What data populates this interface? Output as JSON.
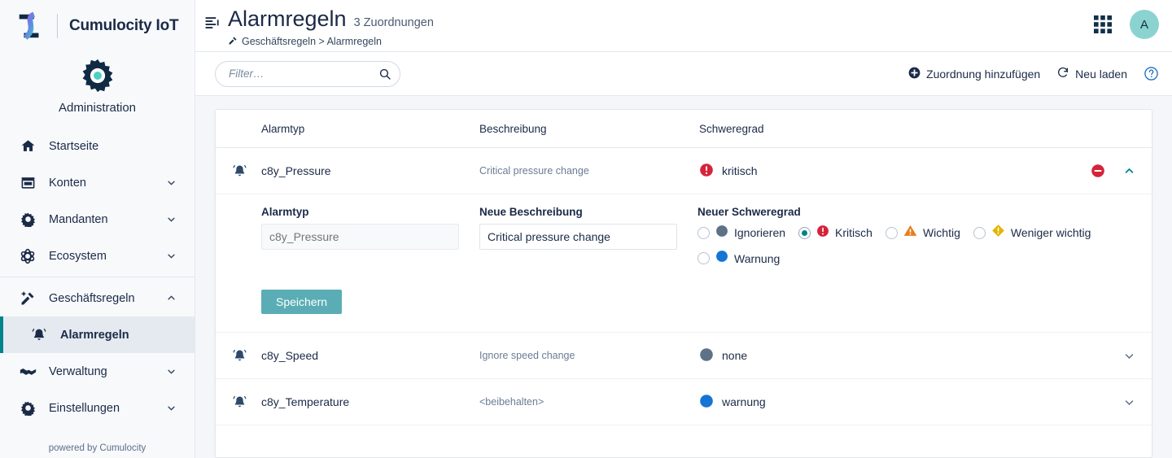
{
  "brand": {
    "name": "Cumulocity IoT",
    "app_title": "Administration",
    "footer": "powered by Cumulocity"
  },
  "sidebar": {
    "items": [
      {
        "label": "Startseite",
        "icon": "home-icon",
        "expandable": false,
        "active": false
      },
      {
        "label": "Konten",
        "icon": "accounts-icon",
        "expandable": true,
        "active": false
      },
      {
        "label": "Mandanten",
        "icon": "tenants-gear-icon",
        "expandable": true,
        "active": false
      },
      {
        "label": "Ecosystem",
        "icon": "ecosystem-atom-icon",
        "expandable": true,
        "active": false
      },
      {
        "label": "Geschäftsregeln",
        "icon": "business-rules-icon",
        "expandable": true,
        "expanded": true,
        "active": false
      },
      {
        "label": "Alarmregeln",
        "icon": "alarm-bell-icon",
        "expandable": false,
        "active": true,
        "sub": true
      },
      {
        "label": "Verwaltung",
        "icon": "management-handshake-icon",
        "expandable": true,
        "active": false
      },
      {
        "label": "Einstellungen",
        "icon": "settings-gear-icon",
        "expandable": true,
        "active": false
      }
    ]
  },
  "header": {
    "title": "Alarmregeln",
    "count": "3 Zuordnungen",
    "breadcrumb": "Geschäftsregeln > Alarmregeln",
    "avatar_initial": "A"
  },
  "toolbar": {
    "filter_placeholder": "Filter…",
    "filter_value": "",
    "add_label": "Zuordnung hinzufügen",
    "reload_label": "Neu laden"
  },
  "table": {
    "headers": {
      "type": "Alarmtyp",
      "description": "Beschreibung",
      "severity": "Schweregrad"
    },
    "rows": [
      {
        "type": "c8y_Pressure",
        "description": "Critical pressure change",
        "severity_label": "kritisch",
        "severity_kind": "critical",
        "expanded": true
      },
      {
        "type": "c8y_Speed",
        "description": "Ignore speed change",
        "severity_label": "none",
        "severity_kind": "none",
        "expanded": false
      },
      {
        "type": "c8y_Temperature",
        "description": "<beibehalten>",
        "severity_label": "warnung",
        "severity_kind": "warning",
        "expanded": false
      }
    ]
  },
  "form": {
    "label_type": "Alarmtyp",
    "type_placeholder": "c8y_Pressure",
    "type_value": "",
    "label_description": "Neue Beschreibung",
    "description_value": "Critical pressure change",
    "label_severity": "Neuer Schweregrad",
    "save_label": "Speichern",
    "severity_options": [
      {
        "label": "Ignorieren",
        "kind": "none",
        "selected": false
      },
      {
        "label": "Kritisch",
        "kind": "critical",
        "selected": true
      },
      {
        "label": "Wichtig",
        "kind": "major",
        "selected": false
      },
      {
        "label": "Weniger wichtig",
        "kind": "minor",
        "selected": false
      },
      {
        "label": "Warnung",
        "kind": "warning",
        "selected": false
      }
    ]
  },
  "colors": {
    "brand_navy": "#1b2a47",
    "accent_teal": "#00838b",
    "critical_red": "#d5233a",
    "major_orange": "#e87d1e",
    "minor_yellow": "#e3b505",
    "warning_blue": "#1574d4",
    "none_gray": "#5d7287",
    "save_button": "#5aadb5",
    "avatar_bg": "#8bd3d0"
  }
}
